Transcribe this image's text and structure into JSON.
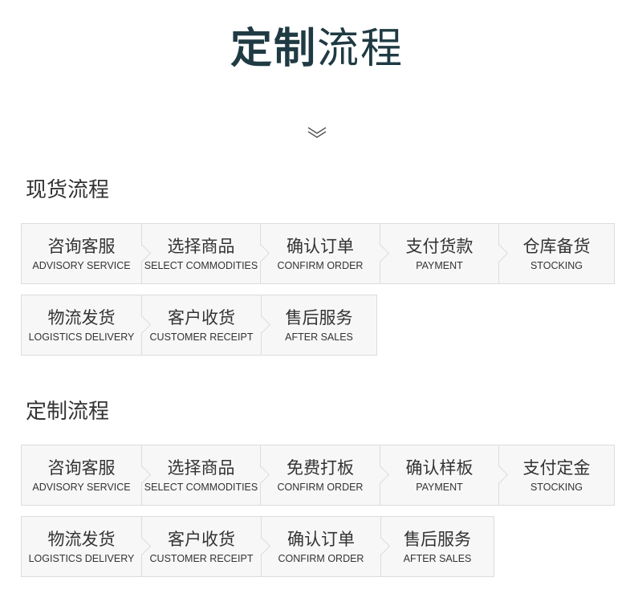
{
  "header": {
    "title_bold": "定制",
    "title_light": "流程",
    "divider_icon": "double-chevron-down-icon"
  },
  "stock_flow": {
    "title": "现货流程",
    "row1": [
      {
        "cn": "咨询客服",
        "en": "ADVISORY SERVICE"
      },
      {
        "cn": "选择商品",
        "en": "SELECT COMMODITIES"
      },
      {
        "cn": "确认订单",
        "en": "CONFIRM ORDER"
      },
      {
        "cn": "支付货款",
        "en": "PAYMENT"
      },
      {
        "cn": "仓库备货",
        "en": "STOCKING"
      }
    ],
    "row2": [
      {
        "cn": "物流发货",
        "en": "LOGISTICS DELIVERY"
      },
      {
        "cn": "客户收货",
        "en": "CUSTOMER RECEIPT"
      },
      {
        "cn": "售后服务",
        "en": "AFTER SALES"
      }
    ]
  },
  "custom_flow": {
    "title": "定制流程",
    "row1": [
      {
        "cn": "咨询客服",
        "en": "ADVISORY SERVICE"
      },
      {
        "cn": "选择商品",
        "en": "SELECT COMMODITIES"
      },
      {
        "cn": "免费打板",
        "en": "CONFIRM ORDER"
      },
      {
        "cn": "确认样板",
        "en": "PAYMENT"
      },
      {
        "cn": "支付定金",
        "en": "STOCKING"
      }
    ],
    "row2": [
      {
        "cn": "物流发货",
        "en": "LOGISTICS DELIVERY"
      },
      {
        "cn": "客户收货",
        "en": "CUSTOMER RECEIPT"
      },
      {
        "cn": "确认订单",
        "en": "CONFIRM ORDER"
      },
      {
        "cn": "售后服务",
        "en": "AFTER SALES"
      }
    ]
  },
  "colors": {
    "title": "#1f3a43",
    "text": "#333333",
    "box_bg": "#f7f7f7",
    "box_border": "#dcdcdc"
  }
}
